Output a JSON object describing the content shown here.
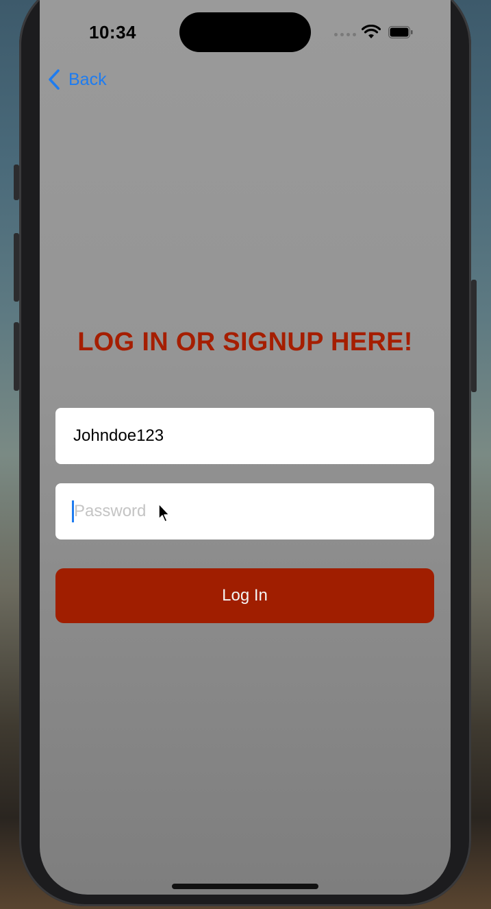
{
  "status_bar": {
    "time": "10:34"
  },
  "nav": {
    "back_label": "Back"
  },
  "main": {
    "heading": "LOG IN OR SIGNUP HERE!",
    "username_value": "Johndoe123",
    "password_placeholder": "Password",
    "login_label": "Log In"
  },
  "colors": {
    "accent_blue": "#1e7cf0",
    "brand_red": "#a01e00",
    "screen_gray": "#9a9a9a"
  },
  "icons": {
    "back": "chevron-left-icon",
    "wifi": "wifi-icon",
    "battery": "battery-icon",
    "signal": "cellular-signal-icon",
    "pointer": "mouse-pointer-icon"
  }
}
